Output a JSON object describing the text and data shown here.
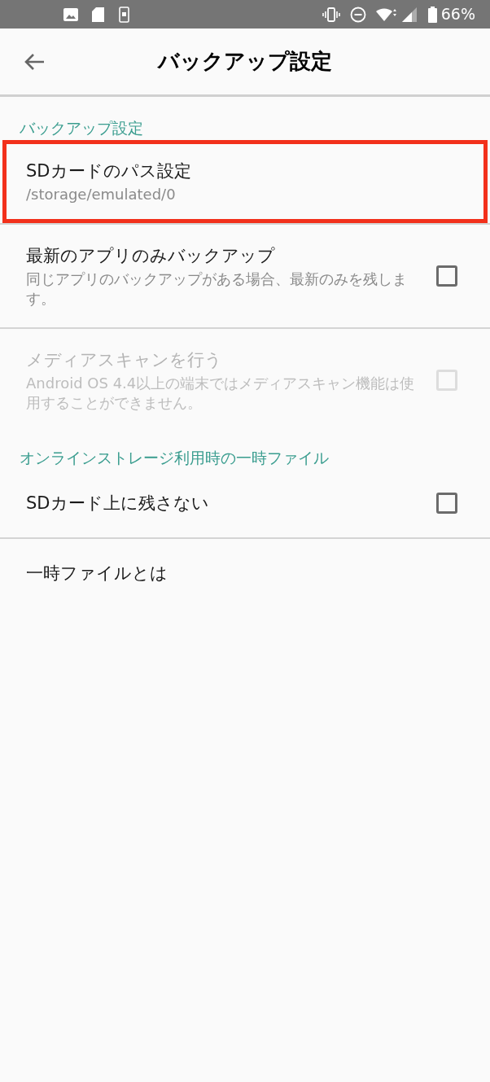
{
  "status_bar": {
    "battery": "66%"
  },
  "toolbar": {
    "title": "バックアップ設定"
  },
  "sections": [
    {
      "header": "バックアップ設定",
      "items": [
        {
          "kind": "text",
          "title": "SDカードのパス設定",
          "summary": "/storage/emulated/0",
          "highlighted": true,
          "disabled": false
        },
        {
          "kind": "checkbox",
          "title": "最新のアプリのみバックアップ",
          "summary": "同じアプリのバックアップがある場合、最新のみを残します。",
          "checked": false,
          "highlighted": false,
          "disabled": false
        },
        {
          "kind": "checkbox",
          "title": "メディアスキャンを行う",
          "summary": "Android OS 4.4以上の端末ではメディアスキャン機能は使用することができません。",
          "checked": false,
          "highlighted": false,
          "disabled": true
        }
      ]
    },
    {
      "header": "オンラインストレージ利用時の一時ファイル",
      "items": [
        {
          "kind": "checkbox",
          "title": "SDカード上に残さない",
          "checked": false,
          "highlighted": false,
          "disabled": false
        },
        {
          "kind": "text",
          "title": "一時ファイルとは",
          "highlighted": false,
          "disabled": false
        }
      ]
    }
  ]
}
